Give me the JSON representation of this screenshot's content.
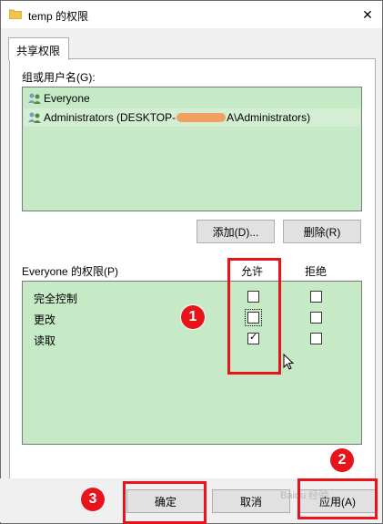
{
  "window": {
    "title": "temp 的权限",
    "close_symbol": "✕"
  },
  "tab": {
    "label": "共享权限"
  },
  "group_label": "组或用户名(G):",
  "users": [
    {
      "name": "Everyone"
    },
    {
      "name_prefix": "Administrators (DESKTOP-",
      "name_suffix": "A\\Administrators)"
    }
  ],
  "buttons": {
    "add": "添加(D)...",
    "remove": "删除(R)",
    "ok": "确定",
    "cancel": "取消",
    "apply": "应用(A)"
  },
  "permissions": {
    "header_label": "Everyone 的权限(P)",
    "allow_header": "允许",
    "deny_header": "拒绝",
    "rows": [
      {
        "name": "完全控制",
        "allow": false,
        "deny": false
      },
      {
        "name": "更改",
        "allow": false,
        "deny": false
      },
      {
        "name": "读取",
        "allow": true,
        "deny": false
      }
    ]
  },
  "annotations": {
    "badge1": "1",
    "badge2": "2",
    "badge3": "3"
  },
  "watermark": "Baidu 经验",
  "colors": {
    "list_bg": "#c6eac6",
    "annotation_red": "#e8141c"
  },
  "icons": [
    "folder-icon",
    "close-icon",
    "user-group-icon",
    "checkbox-check-icon",
    "mouse-cursor-icon"
  ]
}
